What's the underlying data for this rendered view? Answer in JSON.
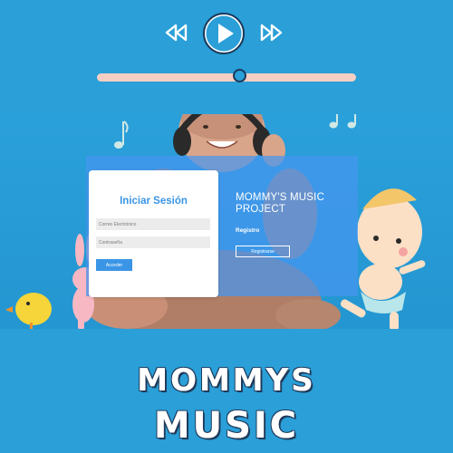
{
  "player": {
    "rewind_icon": "rewind-icon",
    "play_icon": "play-icon",
    "forward_icon": "fast-forward-icon",
    "progress": 0.55,
    "colors": {
      "background": "#2a9fd8",
      "track": "#f6cfc4",
      "accent": "#1a3a5c"
    }
  },
  "login": {
    "title": "Iniciar Sesión",
    "email_placeholder": "Correo Electrónico",
    "password_placeholder": "Contraseña",
    "submit_label": "Acceder",
    "accent": "#3b95e6"
  },
  "register": {
    "project_title": "MOMMY'S MUSIC PROJECT",
    "label": "Registro",
    "button_label": "Registrarse"
  },
  "footer": {
    "line1": "MOMMYS",
    "line2": "MUSIC"
  }
}
